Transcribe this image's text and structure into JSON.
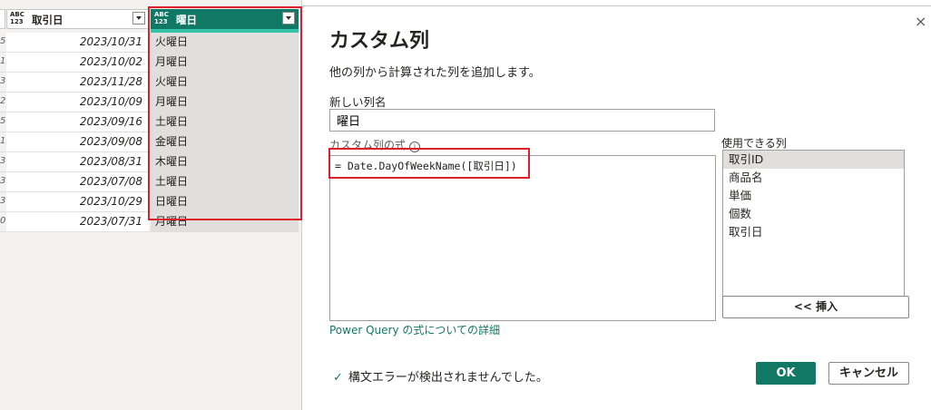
{
  "grid": {
    "columns": [
      {
        "type_icon_top": "ABC",
        "type_icon_bottom": "123",
        "label": "取引日"
      },
      {
        "type_icon_top": "ABC",
        "type_icon_bottom": "123",
        "label": "曜日"
      }
    ],
    "rows": [
      {
        "c0": "5",
        "date": "2023/10/31",
        "weekday": "火曜日"
      },
      {
        "c0": "1",
        "date": "2023/10/02",
        "weekday": "月曜日"
      },
      {
        "c0": "3",
        "date": "2023/11/28",
        "weekday": "火曜日"
      },
      {
        "c0": "2",
        "date": "2023/10/09",
        "weekday": "月曜日"
      },
      {
        "c0": "5",
        "date": "2023/09/16",
        "weekday": "土曜日"
      },
      {
        "c0": "1",
        "date": "2023/09/08",
        "weekday": "金曜日"
      },
      {
        "c0": "3",
        "date": "2023/08/31",
        "weekday": "木曜日"
      },
      {
        "c0": "3",
        "date": "2023/07/08",
        "weekday": "土曜日"
      },
      {
        "c0": "3",
        "date": "2023/10/29",
        "weekday": "日曜日"
      },
      {
        "c0": "0",
        "date": "2023/07/31",
        "weekday": "月曜日"
      }
    ]
  },
  "dialog": {
    "close_icon": "×",
    "title": "カスタム列",
    "description": "他の列から計算された列を追加します。",
    "new_column_label": "新しい列名",
    "new_column_value": "曜日",
    "formula_label": "カスタム列の式",
    "info_icon": "i",
    "formula": "= Date.DayOfWeekName([取引日])",
    "available_columns_label": "使用できる列",
    "available_columns": [
      "取引ID",
      "商品名",
      "単価",
      "個数",
      "取引日"
    ],
    "insert_button": "<< 挿入",
    "link": "Power Query の式についての詳細",
    "status_icon": "✓",
    "status": "構文エラーが検出されませんでした。",
    "ok": "OK",
    "cancel": "キャンセル"
  },
  "colors": {
    "accent": "#117865",
    "highlight": "#e01e2b"
  }
}
